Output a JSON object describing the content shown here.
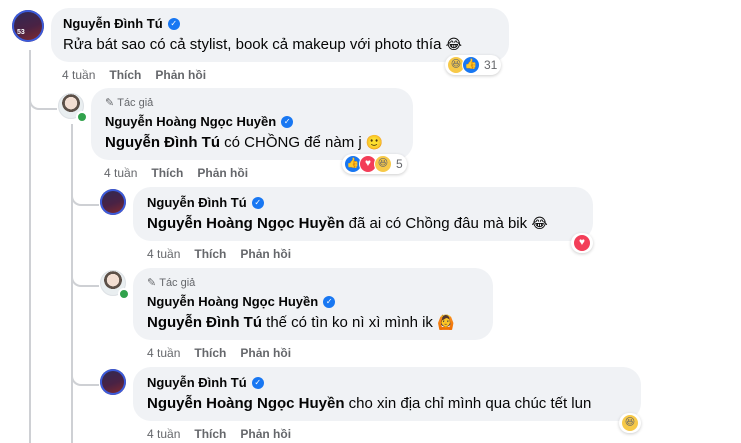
{
  "comments": [
    {
      "author": "Nguyễn Đình Tú",
      "mention": "",
      "text": "Rửa bát sao có cả stylist, book cả makeup với photo thía",
      "emoji": "😂",
      "time": "4 tuần",
      "like_label": "Thích",
      "reply_label": "Phản hồi",
      "reaction_count": "31",
      "avatar_badge": "53"
    },
    {
      "author_tag": "Tác giả",
      "author": "Nguyễn Hoàng Ngọc Huyền",
      "mention": "Nguyễn Đình Tú",
      "text": " có CHỒNG để nàm j",
      "emoji": "🙂",
      "time": "4 tuần",
      "like_label": "Thích",
      "reply_label": "Phản hồi",
      "reaction_count": "5"
    },
    {
      "author": "Nguyễn Đình Tú",
      "mention": "Nguyễn Hoàng Ngọc Huyền",
      "text": " đã ai có Chồng đâu mà bik",
      "emoji": "😂",
      "time": "4 tuần",
      "like_label": "Thích",
      "reply_label": "Phản hồi"
    },
    {
      "author_tag": "Tác giả",
      "author": "Nguyễn Hoàng Ngọc Huyền",
      "mention": "Nguyễn Đình Tú",
      "text": " thế có tìn ko nì xì mình ik",
      "emoji": "🙆",
      "time": "4 tuần",
      "like_label": "Thích",
      "reply_label": "Phản hồi"
    },
    {
      "author": "Nguyễn Đình Tú",
      "mention": "Nguyễn Hoàng Ngọc Huyền",
      "text": " cho xin địa chỉ mình qua chúc tết lun",
      "emoji": "",
      "time": "4 tuần",
      "like_label": "Thích",
      "reply_label": "Phản hồi"
    }
  ],
  "icons": {
    "verified": "verified-badge-icon",
    "author_tag": "pencil-icon",
    "haha": "haha-reaction-icon",
    "like": "like-reaction-icon",
    "love": "love-reaction-icon"
  },
  "colors": {
    "link_blue": "#1877f2",
    "bubble": "#f0f2f5",
    "meta": "#65676b"
  }
}
